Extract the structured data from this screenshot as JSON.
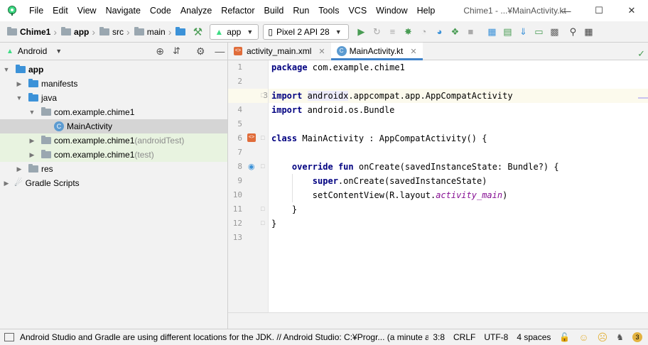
{
  "menu": {
    "items": [
      "File",
      "Edit",
      "View",
      "Navigate",
      "Code",
      "Analyze",
      "Refactor",
      "Build",
      "Run",
      "Tools",
      "VCS",
      "Window",
      "Help"
    ],
    "window_title": "Chime1 - ...¥MainActivity.kt"
  },
  "navbar": {
    "breadcrumbs": [
      "Chime1",
      "app",
      "src",
      "main"
    ],
    "config": "app",
    "device": "Pixel 2 API 28"
  },
  "project": {
    "view_mode": "Android",
    "tree": [
      {
        "label": "app",
        "suffix": ""
      },
      {
        "label": "manifests",
        "suffix": ""
      },
      {
        "label": "java",
        "suffix": ""
      },
      {
        "label": "com.example.chime1",
        "suffix": ""
      },
      {
        "label": "MainActivity",
        "suffix": ""
      },
      {
        "label": "com.example.chime1",
        "suffix": " (androidTest)"
      },
      {
        "label": "com.example.chime1",
        "suffix": " (test)"
      },
      {
        "label": "res",
        "suffix": ""
      },
      {
        "label": "Gradle Scripts",
        "suffix": ""
      }
    ]
  },
  "editor": {
    "tabs": [
      "activity_main.xml",
      "MainActivity.kt"
    ],
    "line_numbers": [
      "1",
      "2",
      "3",
      "4",
      "5",
      "6",
      "7",
      "8",
      "9",
      "10",
      "11",
      "12",
      "13"
    ],
    "code": {
      "l1_kw": "package",
      "l1_rest": " com.example.chime1",
      "l3_kw": "import",
      "l3_hl": "androidx",
      "l3_rest": ".appcompat.app.AppCompatActivity",
      "l4_kw": "import",
      "l4_rest": " android.os.Bundle",
      "l6_kw": "class",
      "l6_rest": " MainActivity : AppCompatActivity() {",
      "l8_kw1": "override",
      "l8_kw2": "fun",
      "l8_rest": " onCreate(savedInstanceState: Bundle?) {",
      "l9_kw": "super",
      "l9_rest": ".onCreate(savedInstanceState)",
      "l10_a": "setContentView(R.layout.",
      "l10_it": "activity_main",
      "l10_b": ")",
      "l11": "}",
      "l12": "}"
    }
  },
  "status": {
    "message": "Android Studio and Gradle are using different locations for the JDK. // Android Studio: C:¥Progr... (a minute ago)",
    "position": "3:8",
    "line_sep": "CRLF",
    "encoding": "UTF-8",
    "indent": "4 spaces",
    "notif_count": "3"
  },
  "colors": {
    "accent": "#4083c9",
    "android_green": "#3ddc84",
    "run_green": "#499c54",
    "keyword": "#000080"
  }
}
